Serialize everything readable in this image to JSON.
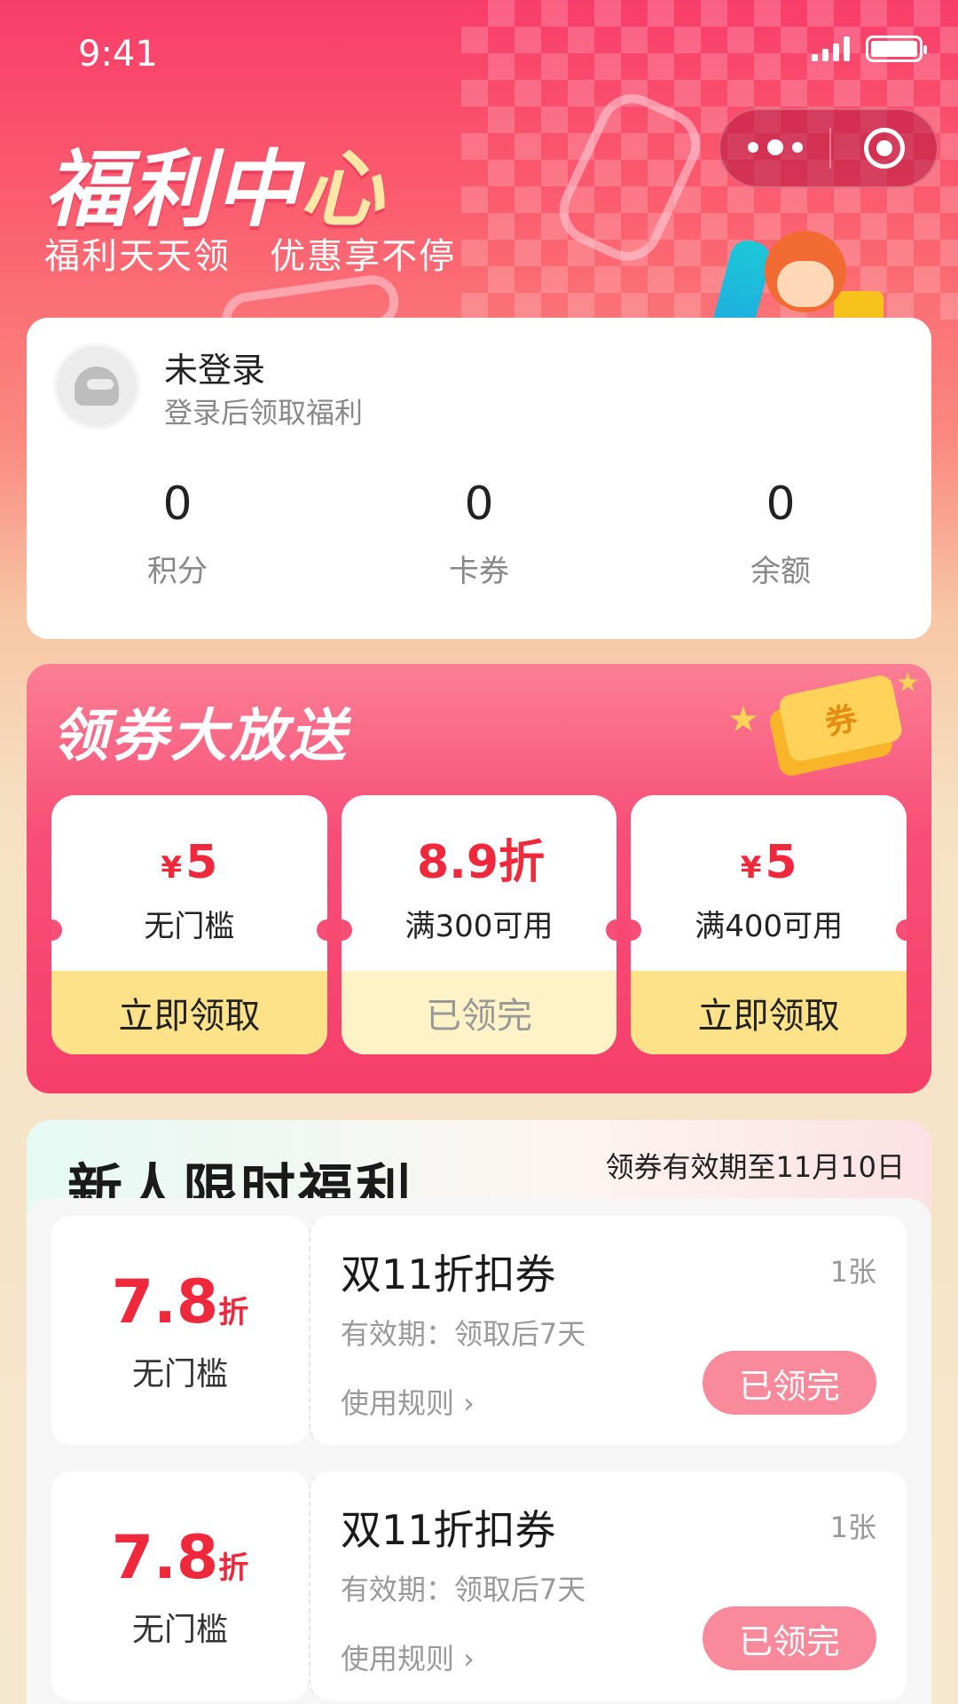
{
  "status_bar": {
    "time": "9:41"
  },
  "hero": {
    "title_main": "福利中",
    "title_last": "心",
    "subtitle": "福利天天领   优惠享不停"
  },
  "user": {
    "name": "未登录",
    "hint": "登录后领取福利",
    "stats": [
      {
        "value": "0",
        "label": "积分"
      },
      {
        "value": "0",
        "label": "卡券"
      },
      {
        "value": "0",
        "label": "余额"
      }
    ]
  },
  "giveaway": {
    "title": "领券大放送",
    "ticket_label": "券",
    "coupons": [
      {
        "currency": "¥",
        "amount": "5",
        "condition": "无门槛",
        "action": "立即领取"
      },
      {
        "currency": "",
        "amount": "8.9折",
        "condition": "满300可用",
        "action": "已领完"
      },
      {
        "currency": "¥",
        "amount": "5",
        "condition": "满400可用",
        "action": "立即领取"
      }
    ]
  },
  "newbie": {
    "title": "新人限时福利",
    "validity_note": "领券有效期至11月10日",
    "items": [
      {
        "value": "7.8",
        "unit": "折",
        "threshold": "无门槛",
        "name": "双11折扣券",
        "quantity": "1张",
        "validity": "有效期：领取后7天",
        "rule_link": "使用规则 ›",
        "status": "已领完"
      },
      {
        "value": "7.8",
        "unit": "折",
        "threshold": "无门槛",
        "name": "双11折扣券",
        "quantity": "1张",
        "validity": "有效期：领取后7天",
        "rule_link": "使用规则 ›",
        "status": "已领完"
      }
    ]
  },
  "colors": {
    "accent": "#f63f6b",
    "price": "#f0283c",
    "button_yellow": "#fde28a"
  }
}
